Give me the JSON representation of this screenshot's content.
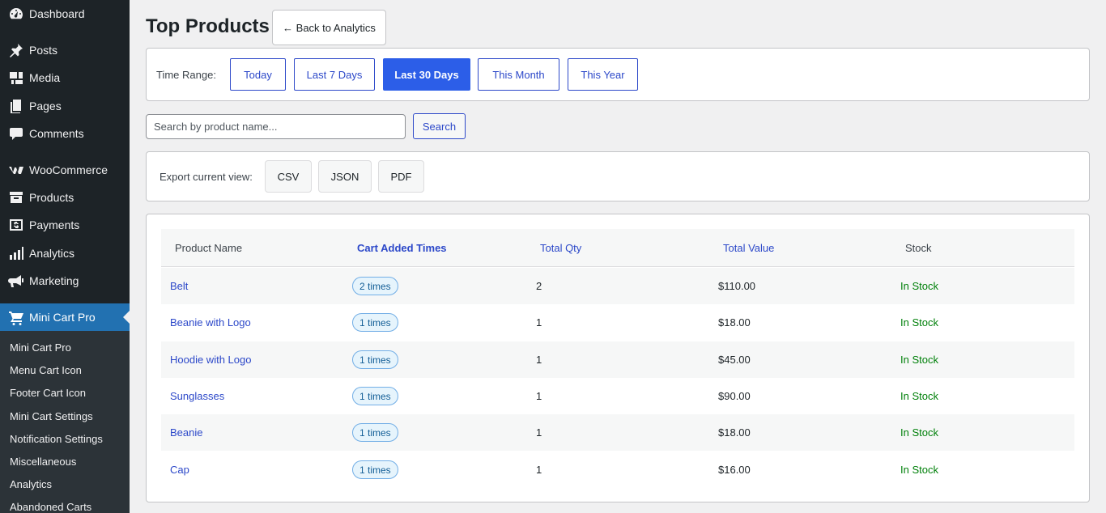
{
  "sidebar": {
    "items": [
      {
        "label": "Dashboard",
        "icon": "dashboard-icon"
      },
      {
        "label": "Posts",
        "icon": "pin-icon"
      },
      {
        "label": "Media",
        "icon": "media-icon"
      },
      {
        "label": "Pages",
        "icon": "pages-icon"
      },
      {
        "label": "Comments",
        "icon": "comments-icon"
      },
      {
        "label": "WooCommerce",
        "icon": "woocommerce-icon"
      },
      {
        "label": "Products",
        "icon": "archive-icon"
      },
      {
        "label": "Payments",
        "icon": "dollar-icon"
      },
      {
        "label": "Analytics",
        "icon": "bar-chart-icon"
      },
      {
        "label": "Marketing",
        "icon": "megaphone-icon"
      },
      {
        "label": "Mini Cart Pro",
        "icon": "cart-icon"
      }
    ],
    "submenu": [
      "Mini Cart Pro",
      "Menu Cart Icon",
      "Footer Cart Icon",
      "Mini Cart Settings",
      "Notification Settings",
      "Miscellaneous",
      "Analytics",
      "Abandoned Carts"
    ]
  },
  "header": {
    "title": "Top Products",
    "back_label": "← Back to Analytics"
  },
  "time_range": {
    "label": "Time Range:",
    "options": [
      "Today",
      "Last 7 Days",
      "Last 30 Days",
      "This Month",
      "This Year"
    ],
    "selected": "Last 30 Days"
  },
  "search": {
    "placeholder": "Search by product name...",
    "value": "",
    "button_label": "Search"
  },
  "export": {
    "label": "Export current view:",
    "buttons": [
      "CSV",
      "JSON",
      "PDF"
    ]
  },
  "table": {
    "columns": [
      "Product Name",
      "Cart Added Times",
      "Total Qty",
      "Total Value",
      "Stock"
    ],
    "rows": [
      {
        "name": "Belt",
        "times": "2 times",
        "qty": "2",
        "value": "$110.00",
        "stock": "In Stock"
      },
      {
        "name": "Beanie with Logo",
        "times": "1 times",
        "qty": "1",
        "value": "$18.00",
        "stock": "In Stock"
      },
      {
        "name": "Hoodie with Logo",
        "times": "1 times",
        "qty": "1",
        "value": "$45.00",
        "stock": "In Stock"
      },
      {
        "name": "Sunglasses",
        "times": "1 times",
        "qty": "1",
        "value": "$90.00",
        "stock": "In Stock"
      },
      {
        "name": "Beanie",
        "times": "1 times",
        "qty": "1",
        "value": "$18.00",
        "stock": "In Stock"
      },
      {
        "name": "Cap",
        "times": "1 times",
        "qty": "1",
        "value": "$16.00",
        "stock": "In Stock"
      }
    ]
  },
  "colors": {
    "sidebar_bg": "#1d2327",
    "active_menu": "#2271b1",
    "accent": "#2c5ee8",
    "link": "#2c48c9",
    "in_stock": "#00800a"
  }
}
